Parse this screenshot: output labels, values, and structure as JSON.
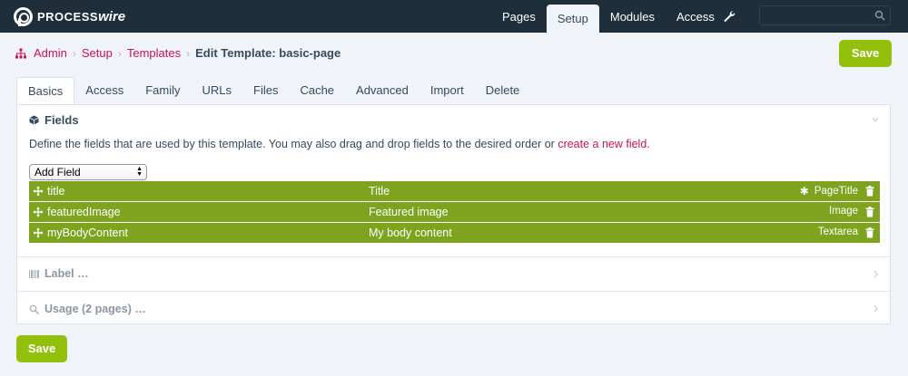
{
  "app": {
    "logo_text_bold": "PROCESS",
    "logo_text_italic": "wire"
  },
  "topnav": {
    "items": [
      "Pages",
      "Setup",
      "Modules",
      "Access"
    ],
    "active": "Setup"
  },
  "breadcrumb": {
    "items": [
      "Admin",
      "Setup",
      "Templates"
    ],
    "current": "Edit Template: basic-page"
  },
  "buttons": {
    "save_top": "Save",
    "save_bottom": "Save"
  },
  "tabs": [
    "Basics",
    "Access",
    "Family",
    "URLs",
    "Files",
    "Cache",
    "Advanced",
    "Import",
    "Delete"
  ],
  "fields_section": {
    "title": "Fields",
    "description": "Define the fields that are used by this template. You may also drag and drop fields to the desired order or",
    "create_link": "create a new field.",
    "select_value": "Add Field",
    "rows": [
      {
        "name": "title",
        "label": "Title",
        "type": "PageTitle",
        "required": true
      },
      {
        "name": "featuredImage",
        "label": "Featured image",
        "type": "Image",
        "required": false
      },
      {
        "name": "myBodyContent",
        "label": "My body content",
        "type": "Textarea",
        "required": false
      }
    ]
  },
  "collapsed_sections": {
    "label": "Label …",
    "usage": "Usage (2 pages) …"
  },
  "colors": {
    "accent": "#93bf0d",
    "field_row": "#7ea41f",
    "link": "#c7135c",
    "masthead": "#1f2e3b"
  }
}
